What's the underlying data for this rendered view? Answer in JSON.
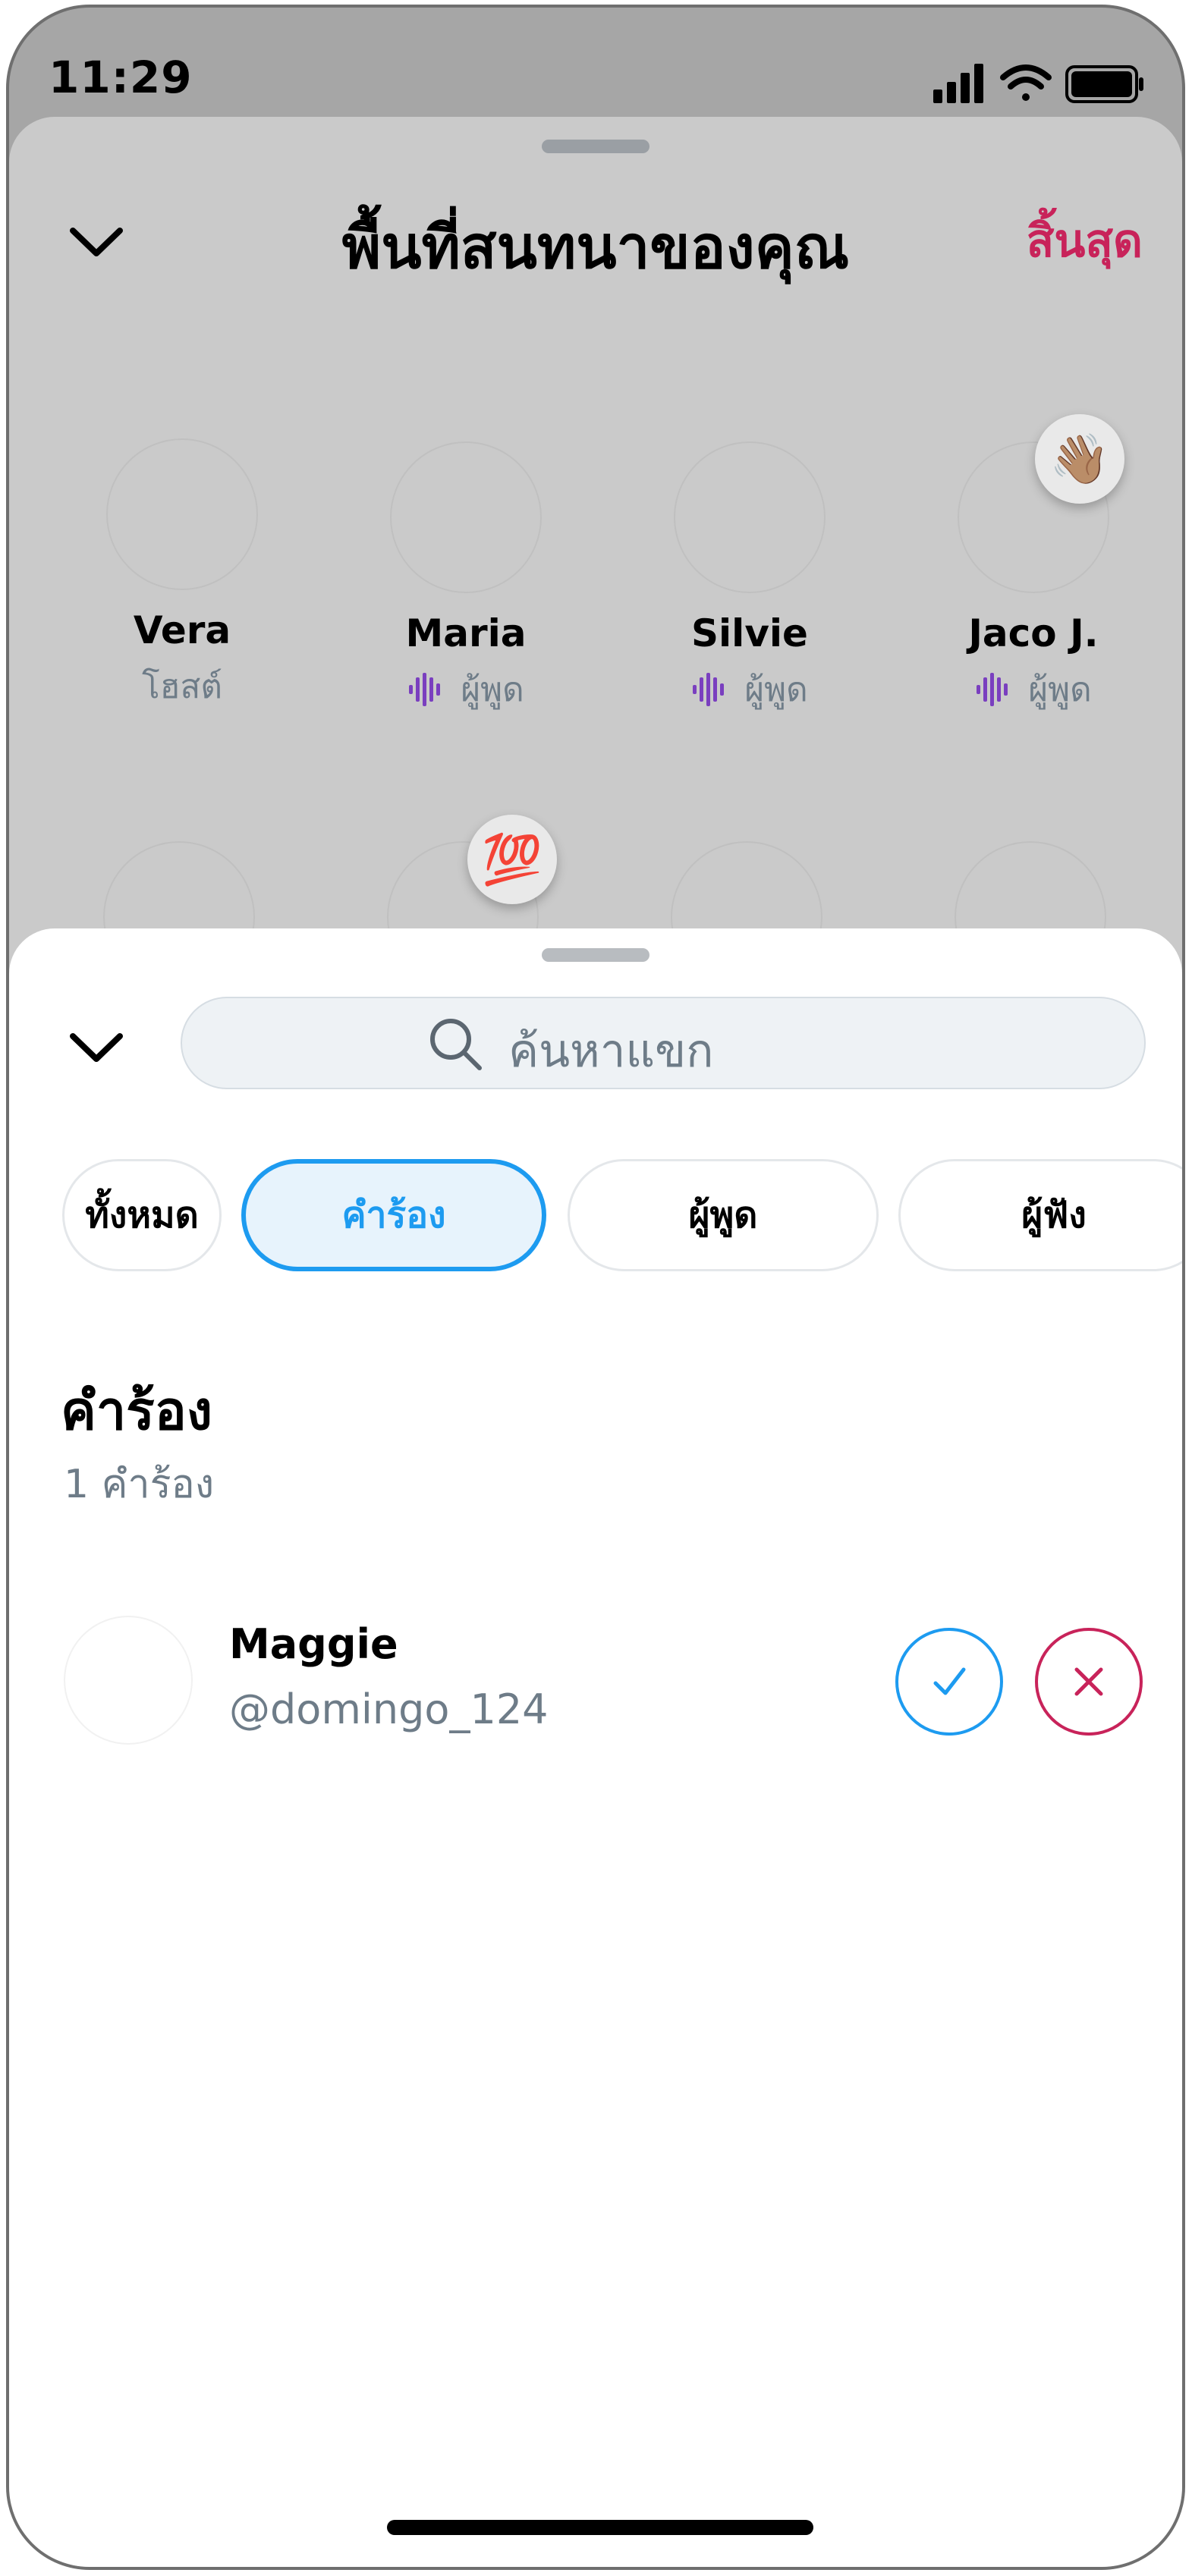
{
  "status_bar": {
    "time": "11:29",
    "icons": [
      "cellular-signal-icon",
      "wifi-icon",
      "battery-icon"
    ]
  },
  "space": {
    "title": "พื้นที่สนทนาของคุณ",
    "end_label": "สิ้นสุด",
    "participants": [
      {
        "name": "Vera",
        "role": "โฮสต์",
        "speaking": false
      },
      {
        "name": "Maria",
        "role": "ผู้พูด",
        "speaking": true
      },
      {
        "name": "Silvie",
        "role": "ผู้พูด",
        "speaking": true
      },
      {
        "name": "Jaco J.",
        "role": "ผู้พูด",
        "speaking": true
      }
    ],
    "reactions": [
      "👋🏽",
      "💯"
    ]
  },
  "sheet": {
    "search_placeholder": "ค้นหาแขก",
    "filters": [
      {
        "label": "ทั้งหมด",
        "active": false
      },
      {
        "label": "คำร้อง",
        "active": true
      },
      {
        "label": "ผู้พูด",
        "active": false
      },
      {
        "label": "ผู้ฟัง",
        "active": false
      }
    ],
    "section_title": "คำร้อง",
    "section_count": "1 คำร้อง",
    "request": {
      "name": "Maggie",
      "handle": "@domingo_124"
    }
  },
  "colors": {
    "accent": "#1d9bf0",
    "danger": "#c8235a",
    "secondary_text": "#6e7c88",
    "speaking_purple": "#7a3fbf"
  }
}
